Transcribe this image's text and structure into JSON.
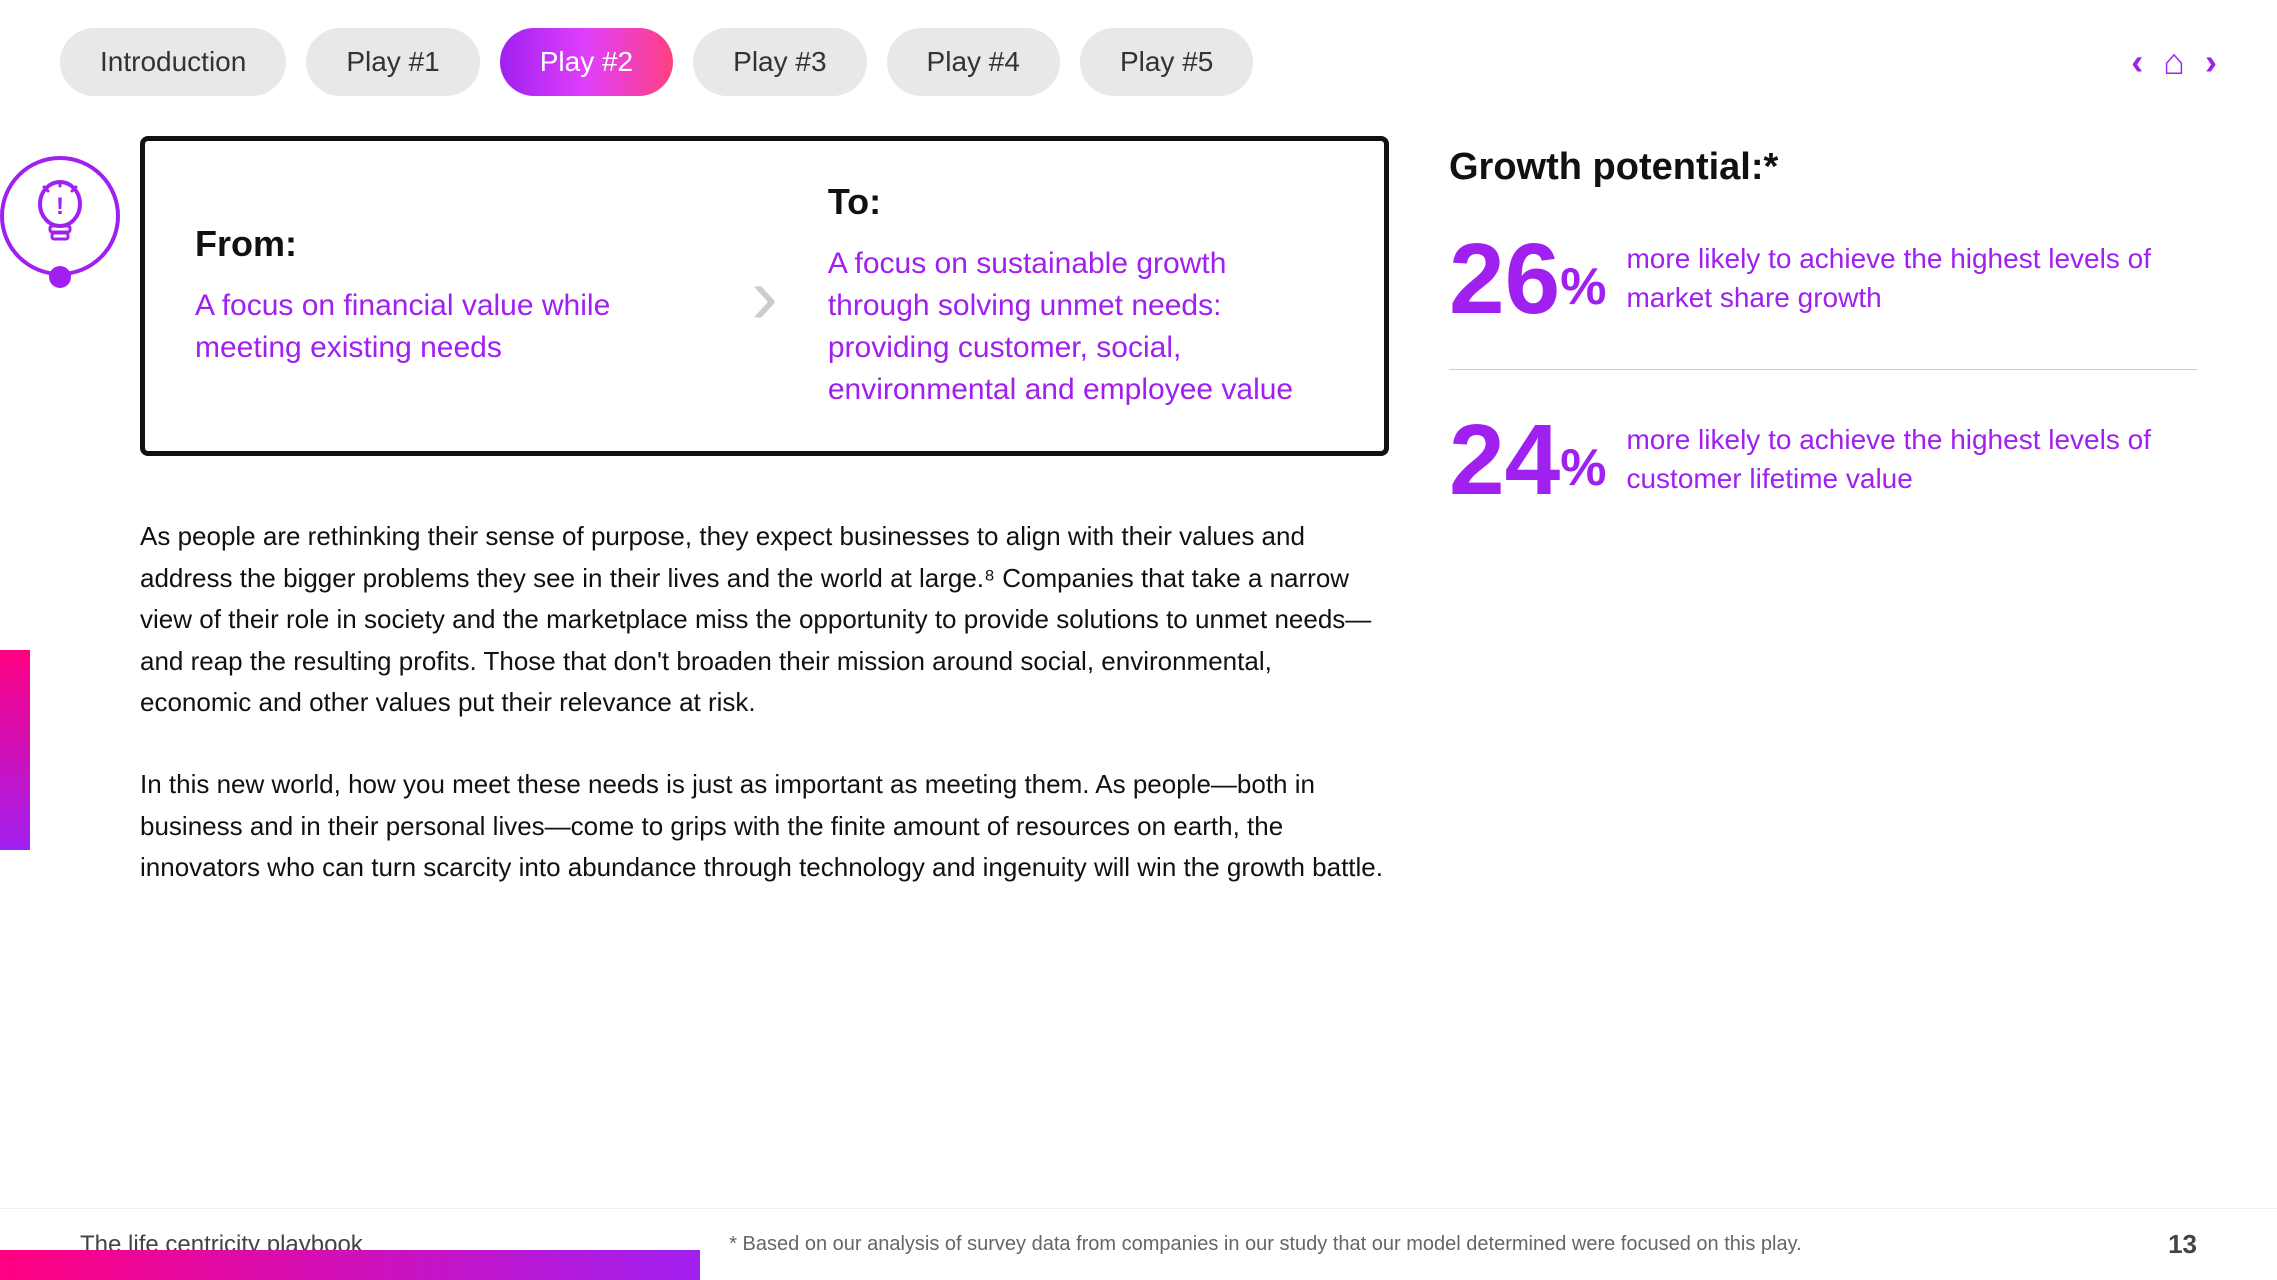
{
  "nav": {
    "tabs": [
      {
        "id": "intro",
        "label": "Introduction",
        "active": false
      },
      {
        "id": "play1",
        "label": "Play #1",
        "active": false
      },
      {
        "id": "play2",
        "label": "Play #2",
        "active": true
      },
      {
        "id": "play3",
        "label": "Play #3",
        "active": false
      },
      {
        "id": "play4",
        "label": "Play #4",
        "active": false
      },
      {
        "id": "play5",
        "label": "Play #5",
        "active": false
      }
    ],
    "prev_arrow": "‹",
    "home_icon": "⌂",
    "next_arrow": "›"
  },
  "from_to": {
    "from_label": "From:",
    "from_text": "A focus on financial value while meeting existing needs",
    "to_label": "To:",
    "to_text": "A focus on sustainable growth through solving unmet needs: providing customer, social, environmental and employee value"
  },
  "body": {
    "paragraph1": "As people are rethinking their sense of purpose, they expect businesses to align with their values and address the bigger problems they see in their lives and the world at large.⁸ Companies that take a narrow view of their role in society and the marketplace miss the opportunity to provide solutions to unmet needs—and reap the resulting profits. Those that don't broaden their mission around social, environmental, economic and other values put their relevance at risk.",
    "paragraph2": "In this new world, how you meet these needs is just as important as meeting them. As people—both in business and in their personal lives—come to grips with the finite amount of resources on earth, the innovators who can turn scarcity into abundance through technology and ingenuity will win the growth battle."
  },
  "growth": {
    "title": "Growth potential:*",
    "stat1_number": "26",
    "stat1_percent": "%",
    "stat1_text": "more likely to achieve the highest levels of market share growth",
    "stat2_number": "24",
    "stat2_percent": "%",
    "stat2_text": "more likely to achieve the highest levels of customer lifetime value"
  },
  "footer": {
    "title": "The life centricity playbook",
    "note": "* Based on our analysis of survey data from companies in our study that our model determined were focused on this play.",
    "page": "13"
  }
}
